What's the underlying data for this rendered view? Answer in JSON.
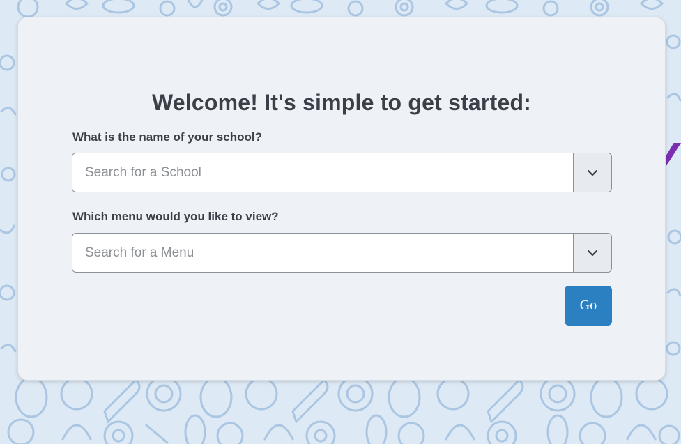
{
  "title": "Welcome! It's simple to get started:",
  "school": {
    "label": "What is the name of your school?",
    "placeholder": "Search for a School"
  },
  "menu": {
    "label": "Which menu would you like to view?",
    "placeholder": "Search for a Menu"
  },
  "go_label": "Go",
  "colors": {
    "accent": "#2b80c1",
    "arrow": "#7b2fb0",
    "background": "#dde9f4",
    "card": "#eef1f6"
  },
  "icons": {
    "dropdown": "chevron-down-icon",
    "annotation": "purple-arrow-icon",
    "background": "fruit-vegetable-pattern"
  }
}
